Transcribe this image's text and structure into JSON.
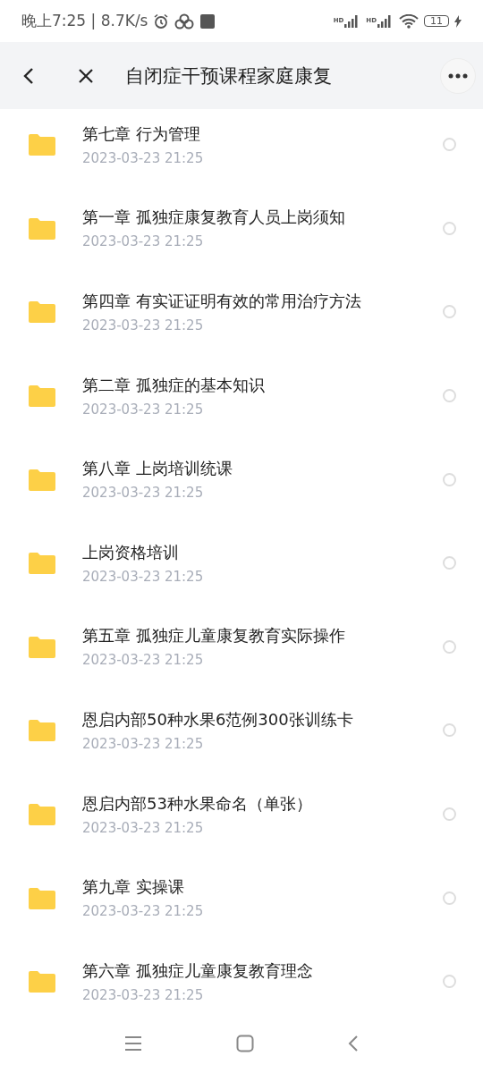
{
  "status_bar": {
    "time": "晚上7:25 | 8.7K/s",
    "signal_labels": [
      "HD",
      "HD"
    ],
    "battery": "11"
  },
  "header": {
    "title": "自闭症干预课程家庭康复"
  },
  "files": [
    {
      "name": "第七章 行为管理",
      "date": "2023-03-23  21:25",
      "selected": false
    },
    {
      "name": "第一章 孤独症康复教育人员上岗须知",
      "date": "2023-03-23  21:25",
      "selected": false
    },
    {
      "name": "第四章 有实证证明有效的常用治疗方法",
      "date": "2023-03-23  21:25",
      "selected": false
    },
    {
      "name": "第二章 孤独症的基本知识",
      "date": "2023-03-23  21:25",
      "selected": false
    },
    {
      "name": "第八章 上岗培训统课",
      "date": "2023-03-23  21:25",
      "selected": false
    },
    {
      "name": "上岗资格培训",
      "date": "2023-03-23  21:25",
      "selected": false
    },
    {
      "name": "第五章 孤独症儿童康复教育实际操作",
      "date": "2023-03-23  21:25",
      "selected": false
    },
    {
      "name": "恩启内部50种水果6范例300张训练卡",
      "date": "2023-03-23  21:25",
      "selected": false
    },
    {
      "name": "恩启内部53种水果命名（单张）",
      "date": "2023-03-23  21:25",
      "selected": false
    },
    {
      "name": "第九章 实操课",
      "date": "2023-03-23  21:25",
      "selected": false
    },
    {
      "name": "第六章 孤独症儿童康复教育理念",
      "date": "2023-03-23  21:25",
      "selected": false
    }
  ]
}
